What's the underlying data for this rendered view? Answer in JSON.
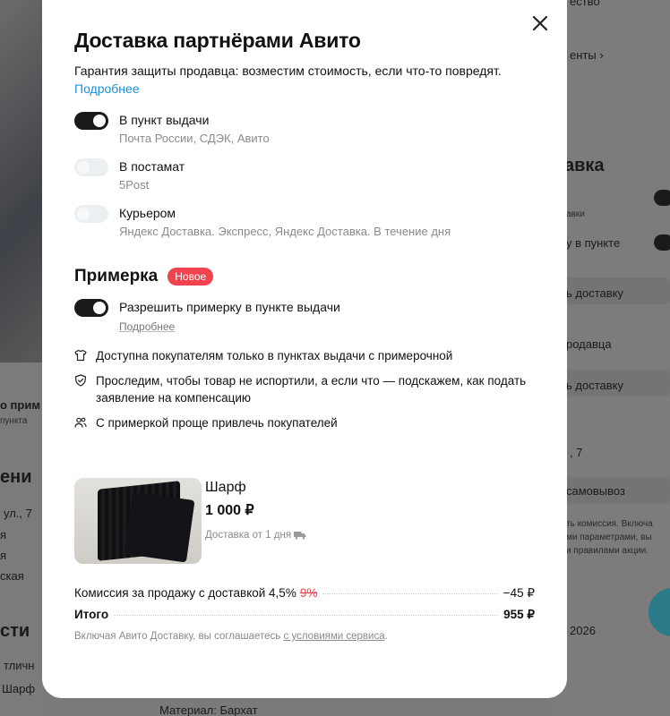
{
  "background": {
    "right_texts": [
      "ество",
      "енты ›",
      "авка",
      "авки",
      "у в пункте",
      "ь доставку",
      "родавца",
      "ь доставку",
      ", 7",
      "самовывоз",
      "ть комиссия. Включа",
      "ми параметрами, вы",
      "и правилами акции.",
      "2026"
    ],
    "left_texts": [
      "о прим",
      "пункта",
      "ени",
      "ул., 7",
      "я",
      "я",
      "ская",
      "сти",
      "тличн",
      "Шарф"
    ],
    "bottom_text": "Материал: Бархат"
  },
  "modal": {
    "title": "Доставка партнёрами Авито",
    "subtitle": "Гарантия защиты продавца: возместим стоимость, если что-то повредят.",
    "subtitle_link": "Подробнее",
    "options": [
      {
        "title": "В пункт выдачи",
        "sub": "Почта России, СДЭК, Авито",
        "on": true
      },
      {
        "title": "В постамат",
        "sub": "5Post",
        "on": false
      },
      {
        "title": "Курьером",
        "sub": "Яндекс Доставка. Экспресс, Яндекс Доставка. В течение дня",
        "on": false
      }
    ],
    "fitting": {
      "title": "Примерка",
      "badge": "Новое",
      "toggle_label": "Разрешить примерку в пункте выдачи",
      "toggle_on": true,
      "more": "Подробнее",
      "bullets": [
        {
          "icon": "shirt-icon",
          "text": "Доступна покупателям только в пунктах выдачи с примерочной"
        },
        {
          "icon": "shield-check-icon",
          "text": "Проследим, чтобы товар не испортили, а если что — подскажем, как подать заявление на компенсацию"
        },
        {
          "icon": "users-icon",
          "text": "С примеркой проще привлечь покупателей"
        }
      ]
    },
    "product": {
      "name": "Шарф",
      "price": "1 000 ₽",
      "delivery": "Доставка от 1 дня"
    },
    "totals": {
      "commission_label": "Комиссия за продажу с доставкой 4,5%",
      "commission_old": "9%",
      "commission_value": "−45 ₽",
      "total_label": "Итого",
      "total_value": "955 ₽"
    },
    "terms_prefix": "Включая Авито Доставку, вы соглашаетесь",
    "terms_link": "с условиями сервиса",
    "terms_suffix": "."
  }
}
